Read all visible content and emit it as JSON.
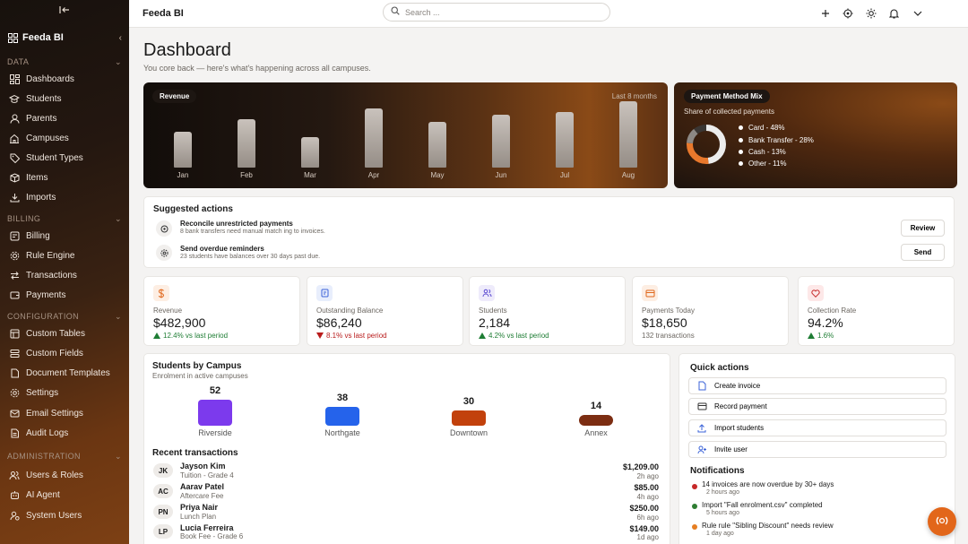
{
  "app": {
    "title": "Feeda BI"
  },
  "sidebar": {
    "brand": "Feeda BI",
    "sections": [
      {
        "title": "DATA",
        "items": [
          "Dashboards",
          "Students",
          "Parents",
          "Campuses",
          "Student Types",
          "Items",
          "Imports"
        ]
      },
      {
        "title": "BILLING",
        "items": [
          "Billing",
          "Rule Engine",
          "Transactions",
          "Payments"
        ]
      },
      {
        "title": "CONFIGURATION",
        "items": [
          "Custom Tables",
          "Custom Fields",
          "Document Templates",
          "Settings",
          "Email Settings",
          "Audit Logs"
        ]
      },
      {
        "title": "ADMINISTRATION",
        "items": [
          "Users & Roles",
          "AI Agent",
          "System Users"
        ]
      }
    ]
  },
  "search": {
    "placeholder": "Search ..."
  },
  "page": {
    "title": "Dashboard",
    "subtitle": "You core back — here's what's happening across all campuses."
  },
  "revenue_card": {
    "label": "Revenue",
    "period": "Last 8 months"
  },
  "chart_data": {
    "type": "bar",
    "title": "Revenue",
    "categories": [
      "Jan",
      "Feb",
      "Mar",
      "Apr",
      "May",
      "Jun",
      "Jul",
      "Aug"
    ],
    "values": [
      40,
      54,
      34,
      66,
      51,
      59,
      62,
      74
    ]
  },
  "payment_mix": {
    "label": "Payment Method Mix",
    "subtitle": "Share of collected payments",
    "slices": [
      {
        "label": "Card - 48%",
        "value": 48,
        "color": "#ececec"
      },
      {
        "label": "Bank Transfer - 28%",
        "value": 28,
        "color": "#e8782c"
      },
      {
        "label": "Cash - 13%",
        "value": 13,
        "color": "#8c8884"
      },
      {
        "label": "Other - 11%",
        "value": 11,
        "color": "#3a3633"
      }
    ]
  },
  "suggested": {
    "title": "Suggested actions",
    "items": [
      {
        "title": "Reconcile unrestricted payments",
        "sub": "8 bank transfers need manual match ing to invoices.",
        "button": "Review"
      },
      {
        "title": "Send overdue reminders",
        "sub": "23 students have balances over 30 days past due.",
        "button": "Send"
      }
    ]
  },
  "kpis": [
    {
      "label": "Revenue",
      "value": "$482,900",
      "change": "12.4% vs last period",
      "dir": "up"
    },
    {
      "label": "Outstanding Balance",
      "value": "$86,240",
      "change": "8.1% vs last period",
      "dir": "down"
    },
    {
      "label": "Students",
      "value": "2,184",
      "change": "4.2% vs last period",
      "dir": "up"
    },
    {
      "label": "Payments Today",
      "value": "$18,650",
      "change": "132 transactions",
      "dir": "none"
    },
    {
      "label": "Collection Rate",
      "value": "94.2%",
      "change": "1.6%",
      "dir": "up"
    }
  ],
  "campus": {
    "title": "Students by Campus",
    "subtitle": "Enrolment in active campuses",
    "items": [
      {
        "name": "Riverside",
        "count": "52",
        "value": 52,
        "color": "#7c3aed"
      },
      {
        "name": "Northgate",
        "count": "38",
        "value": 38,
        "color": "#2563eb"
      },
      {
        "name": "Downtown",
        "count": "30",
        "value": 30,
        "color": "#c2410c"
      },
      {
        "name": "Annex",
        "count": "14",
        "value": 14,
        "color": "#7c2d12"
      }
    ]
  },
  "transactions": {
    "title": "Recent transactions",
    "rows": [
      {
        "initials": "JK",
        "name": "Jayson Kim",
        "desc": "Tuition - Grade 4",
        "amount": "$1,209.00",
        "time": "2h ago"
      },
      {
        "initials": "AC",
        "name": "Aarav Patel",
        "desc": "Aftercare Fee",
        "amount": "$85.00",
        "time": "4h ago"
      },
      {
        "initials": "PN",
        "name": "Priya Nair",
        "desc": "Lunch Plan",
        "amount": "$250.00",
        "time": "6h ago"
      },
      {
        "initials": "LP",
        "name": "Lucia Ferreira",
        "desc": "Book Fee - Grade 6",
        "amount": "$149.00",
        "time": "1d ago"
      }
    ]
  },
  "quick": {
    "title": "Quick actions",
    "items": [
      "Create invoice",
      "Record payment",
      "Import students",
      "Invite user"
    ]
  },
  "notifications": {
    "title": "Notifications",
    "items": [
      {
        "text": "14 invoices are now overdue by 30+ days",
        "time": "2 hours ago",
        "color": "#c62828"
      },
      {
        "text": "Import \"Fall enrolment.csv\" completed",
        "time": "5 hours ago",
        "color": "#2e7d32"
      },
      {
        "text": "Rule rule \"Sibling Discount\" needs review",
        "time": "1 day ago",
        "color": "#e67e22"
      }
    ]
  }
}
